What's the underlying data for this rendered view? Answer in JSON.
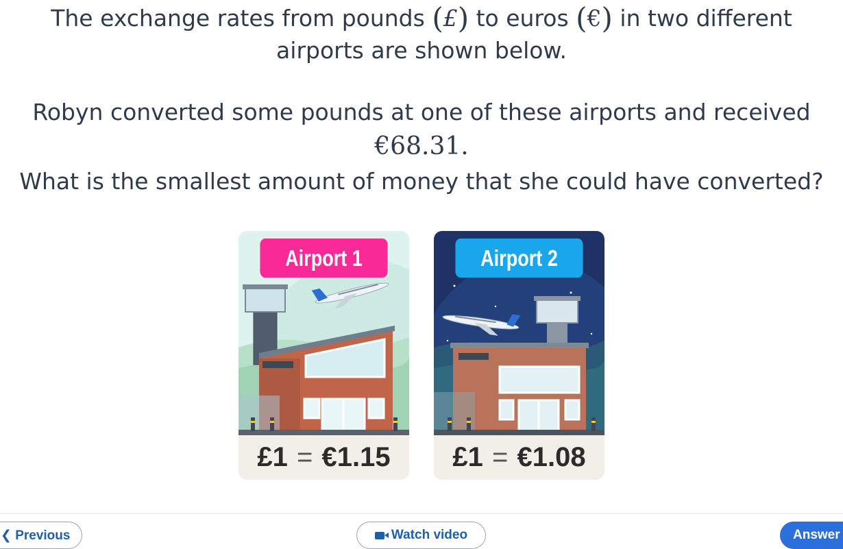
{
  "question": {
    "line1_before": "The exchange rates from pounds ",
    "pound_symbol": "£",
    "line1_middle": " to euros ",
    "euro_symbol": "€",
    "line1_after": " in two different",
    "line2": "airports are shown below.",
    "line3": "Robyn converted some pounds at one of these airports and received",
    "amount": "€68.31.",
    "line5": "What is the smallest amount of money that she could have converted?"
  },
  "cards": [
    {
      "label": "Airport 1",
      "label_color": "#f72a97",
      "rate_left": "£1",
      "rate_eq": "=",
      "rate_right": "€1.15",
      "scene": "day"
    },
    {
      "label": "Airport 2",
      "label_color": "#1aa6ea",
      "rate_left": "£1",
      "rate_eq": "=",
      "rate_right": "€1.08",
      "scene": "night"
    }
  ],
  "footer": {
    "previous_label": "Previous",
    "previous_icon": "chevron-left-icon",
    "watch_label": "Watch video",
    "watch_icon": "video-camera-icon",
    "answer_label": "Answer"
  }
}
